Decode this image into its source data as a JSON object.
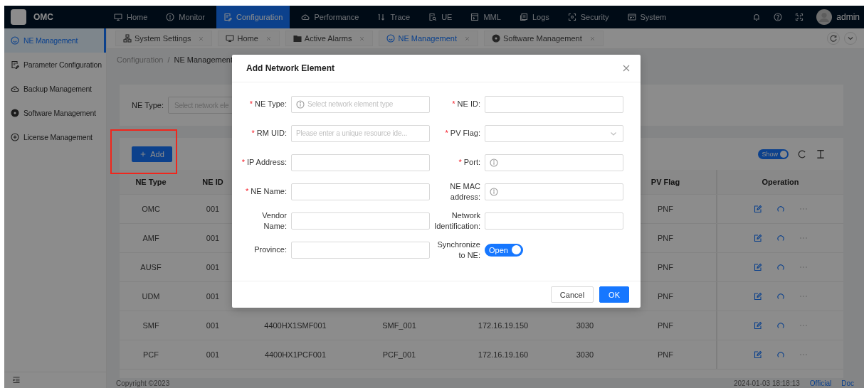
{
  "nav": {
    "brand": "OMC",
    "menu": [
      {
        "label": "Home",
        "selected": false
      },
      {
        "label": "Monitor",
        "selected": false
      },
      {
        "label": "Configuration",
        "selected": true
      },
      {
        "label": "Performance",
        "selected": false
      },
      {
        "label": "Trace",
        "selected": false
      },
      {
        "label": "UE",
        "selected": false
      },
      {
        "label": "MML",
        "selected": false
      },
      {
        "label": "Logs",
        "selected": false
      },
      {
        "label": "Security",
        "selected": false
      },
      {
        "label": "System",
        "selected": false
      }
    ],
    "user": "admin"
  },
  "sidebar": {
    "items": [
      {
        "label": "NE Management",
        "selected": true
      },
      {
        "label": "Parameter Configuration",
        "selected": false
      },
      {
        "label": "Backup Management",
        "selected": false
      },
      {
        "label": "Software Management",
        "selected": false
      },
      {
        "label": "License Management",
        "selected": false
      }
    ]
  },
  "tabs": [
    {
      "label": "System Settings",
      "selected": false
    },
    {
      "label": "Home",
      "selected": false
    },
    {
      "label": "Active Alarms",
      "selected": false
    },
    {
      "label": "NE Management",
      "selected": true
    },
    {
      "label": "Software Management",
      "selected": false
    }
  ],
  "breadcrumb": {
    "items": [
      "Configuration",
      "NE Management"
    ],
    "separator": "/"
  },
  "search": {
    "label": "NE Type:",
    "placeholder": "Select network ele"
  },
  "table": {
    "add_button": "Add",
    "show_toggle": {
      "text": "Show",
      "on": true
    },
    "columns": [
      "NE Type",
      "NE ID",
      null,
      null,
      null,
      null,
      "PV Flag",
      "Operation"
    ],
    "rows": [
      [
        "OMC",
        "001",
        null,
        null,
        null,
        null,
        "PNF"
      ],
      [
        "AMF",
        "001",
        null,
        null,
        null,
        null,
        "PNF"
      ],
      [
        "AUSF",
        "001",
        null,
        null,
        null,
        null,
        "PNF"
      ],
      [
        "UDM",
        "001",
        null,
        null,
        null,
        null,
        "PNF"
      ],
      [
        "SMF",
        "001",
        "4400HX1SMF001",
        "SMF_001",
        "172.16.19.150",
        "3030",
        "PNF"
      ],
      [
        "PCF",
        "001",
        "4400HX1PCF001",
        "PCF_001",
        "172.16.19.160",
        "3030",
        "PNF"
      ]
    ]
  },
  "footer": {
    "copyright": "Copyright ©2023",
    "time": "2024-01-03 18:18:13",
    "links": [
      "Official",
      "Doc"
    ]
  },
  "modal": {
    "title": "Add Network Element",
    "required_mark": "*",
    "fields": [
      {
        "label": "NE Type:",
        "required": true,
        "kind": "input",
        "placeholder": "Select network element type",
        "info_icon": true
      },
      {
        "label": "NE ID:",
        "required": true,
        "kind": "input",
        "info_icon": false
      },
      {
        "label": "RM UID:",
        "required": true,
        "kind": "input",
        "placeholder": "Please enter a unique resource ide...",
        "info_icon": false
      },
      {
        "label": "PV Flag:",
        "required": true,
        "kind": "select",
        "info_icon": false
      },
      {
        "label": "IP Address:",
        "required": true,
        "kind": "input",
        "info_icon": false
      },
      {
        "label": "Port:",
        "required": true,
        "kind": "input",
        "info_icon": true
      },
      {
        "label": "NE Name:",
        "required": true,
        "kind": "input",
        "info_icon": false
      },
      {
        "label": "NE MAC address:",
        "required": false,
        "kind": "input",
        "info_icon": true
      },
      {
        "label": "Vendor Name:",
        "required": false,
        "kind": "input",
        "info_icon": false
      },
      {
        "label": "Network Identification:",
        "required": false,
        "kind": "input",
        "info_icon": false
      },
      {
        "label": "Province:",
        "required": false,
        "kind": "input",
        "info_icon": false
      },
      {
        "label": "Synchronize to NE:",
        "required": false,
        "kind": "switch",
        "on": true,
        "text": "Open"
      }
    ],
    "buttons": [
      {
        "label": "Cancel",
        "kind": "default"
      },
      {
        "label": "OK",
        "kind": "primary"
      }
    ]
  }
}
